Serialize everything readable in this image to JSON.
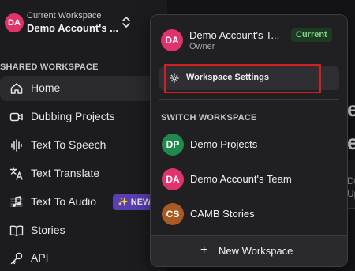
{
  "header": {
    "workspace_caption": "Current Workspace",
    "workspace_name": "Demo Account's ...",
    "avatar_initials": "DA"
  },
  "sidebar": {
    "section_label": "SHARED WORKSPACE",
    "items": [
      {
        "label": "Home",
        "icon": "home-icon",
        "active": true
      },
      {
        "label": "Dubbing Projects",
        "icon": "video-icon"
      },
      {
        "label": "Text To Speech",
        "icon": "waveform-icon"
      },
      {
        "label": "Text Translate",
        "icon": "translate-icon"
      },
      {
        "label": "Text To Audio",
        "icon": "music-notes-icon",
        "badge": "✨ NEW"
      },
      {
        "label": "Stories",
        "icon": "book-icon"
      },
      {
        "label": "API",
        "icon": "key-icon"
      }
    ]
  },
  "main": {
    "heading_fragment_1": "e",
    "heading_fragment_2": "e",
    "card_text_1": "Du",
    "card_text_2": "Up"
  },
  "dropdown": {
    "current": {
      "initials": "DA",
      "name": "Demo Account's T...",
      "role": "Owner",
      "badge": "Current"
    },
    "settings_label": "Workspace Settings",
    "switch_label": "SWITCH WORKSPACE",
    "workspaces": [
      {
        "initials": "DP",
        "name": "Demo Projects",
        "color": "#1f8a4c"
      },
      {
        "initials": "DA",
        "name": "Demo Account's Team",
        "color": "#e0336c"
      },
      {
        "initials": "CS",
        "name": "CAMB Stories",
        "color": "#a85a22"
      }
    ],
    "new_workspace_label": "New Workspace"
  },
  "colors": {
    "accent_pink": "#e0336c",
    "current_green": "#7fd38b",
    "new_badge_purple": "#5a3fb0",
    "highlight_red": "#d22020"
  }
}
